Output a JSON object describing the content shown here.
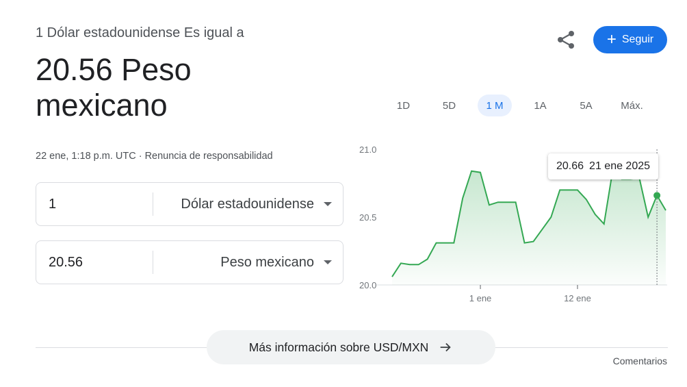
{
  "header": {
    "subtitle": "1 Dólar estadounidense Es igual a",
    "value": "20.56 Peso mexicano",
    "timestamp": "22 ene, 1:18 p.m. UTC · Renuncia de responsabilidad"
  },
  "actions": {
    "share_icon": "share-icon",
    "follow_label": "Seguir",
    "follow_color": "#1a73e8"
  },
  "converter": {
    "from": {
      "amount": "1",
      "currency": "Dólar estadounidense"
    },
    "to": {
      "amount": "20.56",
      "currency": "Peso mexicano"
    }
  },
  "ranges": [
    "1D",
    "5D",
    "1 M",
    "1A",
    "5A",
    "Máx."
  ],
  "active_range": "1 M",
  "tooltip": {
    "value": "20.66",
    "date": "21 ene 2025"
  },
  "chart_data": {
    "type": "area",
    "color": "#34a853",
    "ylim": [
      20.0,
      21.0
    ],
    "yticks": [
      "21.0",
      "20.5",
      "20.0"
    ],
    "xticks": [
      {
        "label": "1 ene",
        "index": 10
      },
      {
        "label": "12 ene",
        "index": 21
      }
    ],
    "grid": false,
    "values": [
      20.06,
      20.16,
      20.15,
      20.15,
      20.19,
      20.31,
      20.31,
      20.31,
      20.64,
      20.84,
      20.83,
      20.59,
      20.61,
      20.61,
      20.61,
      20.31,
      20.32,
      20.41,
      20.5,
      20.7,
      20.7,
      20.7,
      20.63,
      20.52,
      20.45,
      20.85,
      20.78,
      20.78,
      20.79,
      20.5,
      20.66,
      20.55
    ],
    "highlight_index": 30
  },
  "footer": {
    "more_label": "Más información sobre USD/MXN",
    "comments_label": "Comentarios"
  }
}
